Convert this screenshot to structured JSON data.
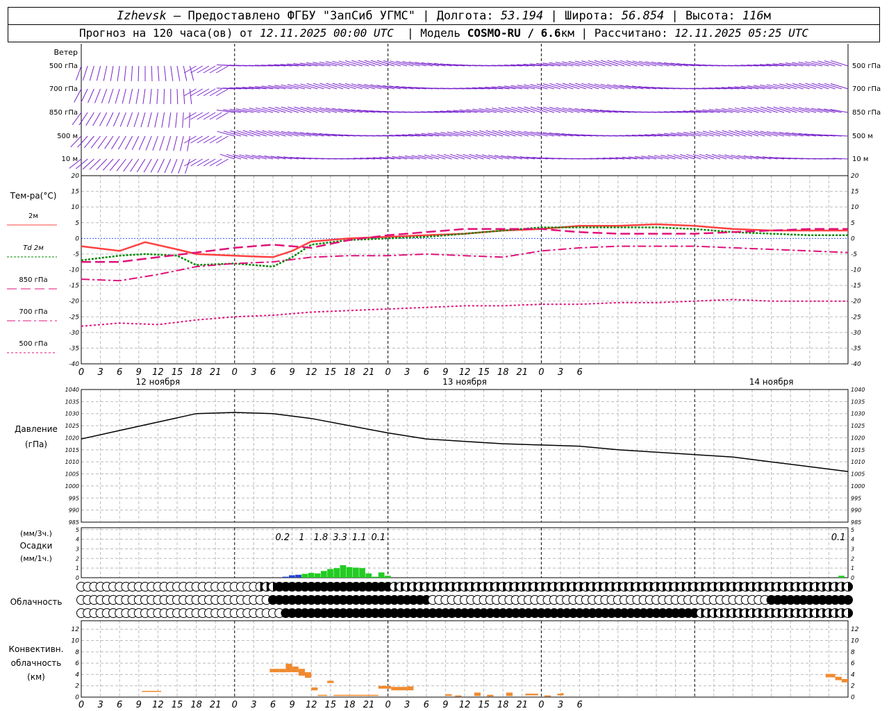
{
  "header": {
    "city": "Izhevsk",
    "provider": "– Предоставлено ФГБУ \"ЗапСиб УГМС\" | Долгота:",
    "lon": "53.194",
    "lat_label": "| Широта:",
    "lat": "56.854",
    "alt_label": "| Высота:",
    "alt": "116",
    "alt_unit": "м",
    "forecast_label": "Прогноз на 120 часа(ов) от",
    "forecast_time": "12.11.2025 00:00 UTC",
    "model_label": "| Модель",
    "model": "COSMO-RU / 6.6",
    "model_unit": "км",
    "calc_label": "| Рассчитано:",
    "calc_time": "12.11.2025 05:25 UTC"
  },
  "time_axis": {
    "hour_labels": [
      "0",
      "3",
      "6",
      "9",
      "12",
      "15",
      "18",
      "21",
      "0",
      "3",
      "6",
      "9",
      "12",
      "15",
      "18",
      "21",
      "0",
      "3",
      "6",
      "9",
      "12",
      "15",
      "18",
      "21",
      "0",
      "3",
      "6"
    ],
    "day_labels": [
      "12 ноября",
      "13 ноября",
      "14 ноября"
    ]
  },
  "wind_panel": {
    "title": "Ветер",
    "levels_left": [
      "500 гПа",
      "700 гПа",
      "850 гПа",
      "500 м",
      "10 м"
    ],
    "levels_right": [
      "500 гПа",
      "700 гПа",
      "850 гПа",
      "500 м",
      "10 м"
    ]
  },
  "temp_panel": {
    "title": "Тем-ра(°C)",
    "legend": [
      {
        "label": "2м",
        "color": "#ff4040",
        "dash": ""
      },
      {
        "label": "Td 2м",
        "color": "#008800",
        "dash": "3,2"
      },
      {
        "label": "850 гПа",
        "color": "#e0107a",
        "dash": "14,6"
      },
      {
        "label": "700 гПа",
        "color": "#e0107a",
        "dash": "12,4,3,4"
      },
      {
        "label": "500 гПа",
        "color": "#e0107a",
        "dash": "3,3"
      }
    ],
    "yticks": [
      "20",
      "15",
      "10",
      "5",
      "0",
      "-5",
      "-10",
      "-15",
      "-20",
      "-25",
      "-30",
      "-35",
      "-40"
    ]
  },
  "pressure_panel": {
    "title": "Давление",
    "unit": "(гПа)",
    "yticks": [
      "1040",
      "1035",
      "1030",
      "1025",
      "1020",
      "1015",
      "1010",
      "1005",
      "1000",
      "995",
      "990",
      "985"
    ]
  },
  "precip_panel": {
    "unit_top": "(мм/3ч.)",
    "title": "Осадки",
    "unit_bottom": "(мм/1ч.)",
    "yticks": [
      "5",
      "4",
      "3",
      "2",
      "1",
      "0"
    ],
    "amounts": [
      "0.2",
      "1",
      "1.8",
      "3.3",
      "1.1",
      "0.1",
      "0.1"
    ]
  },
  "cloud_panel": {
    "title": "Облачность"
  },
  "conv_panel": {
    "title": "Конвективн.",
    "title2": "облачность",
    "unit": "(км)",
    "yticks": [
      "12",
      "10",
      "8",
      "6",
      "4",
      "2",
      "0"
    ]
  },
  "chart_data": [
    {
      "type": "line",
      "title": "Тем-ра(°C)",
      "x_unit": "hours from 12.11.2025 00:00 UTC",
      "ylim": [
        -40,
        20
      ],
      "series": [
        {
          "name": "2м",
          "x": [
            0,
            6,
            10,
            15,
            18,
            24,
            30,
            33,
            36,
            42,
            48,
            54,
            60,
            66,
            72,
            78,
            84,
            90,
            96,
            102,
            108,
            114,
            120
          ],
          "values": [
            -2.5,
            -4.0,
            -1.2,
            -3.5,
            -5.0,
            -5.5,
            -6.0,
            -4.0,
            -1.0,
            0,
            0.5,
            1.0,
            1.5,
            2.5,
            3.0,
            4.0,
            4.0,
            4.5,
            4.0,
            3.0,
            2.5,
            2.5,
            2.5
          ]
        },
        {
          "name": "Td 2м",
          "x": [
            0,
            6,
            10,
            15,
            18,
            24,
            30,
            33,
            36,
            42,
            48,
            54,
            60,
            66,
            72,
            78,
            84,
            90,
            96,
            102,
            108,
            114,
            120
          ],
          "values": [
            -7.0,
            -5.5,
            -5.0,
            -5.5,
            -8.5,
            -8.0,
            -9.0,
            -6.0,
            -2.0,
            -0.5,
            0,
            0.5,
            1.5,
            2.5,
            3.5,
            3.5,
            3.5,
            3.5,
            3.0,
            2.0,
            1.5,
            1.0,
            1.0
          ]
        },
        {
          "name": "850 гПа",
          "x": [
            0,
            6,
            12,
            18,
            24,
            30,
            36,
            42,
            48,
            54,
            60,
            66,
            72,
            78,
            84,
            90,
            96,
            102,
            108,
            114,
            120
          ],
          "values": [
            -7.5,
            -7.5,
            -6.0,
            -4.5,
            -3.0,
            -2.0,
            -3.0,
            -0.5,
            1.0,
            2.0,
            3.0,
            3.0,
            3.0,
            2.0,
            1.5,
            1.5,
            1.5,
            2.0,
            2.5,
            3.0,
            3.0
          ]
        },
        {
          "name": "700 гПа",
          "x": [
            0,
            6,
            12,
            18,
            24,
            30,
            36,
            42,
            48,
            54,
            60,
            66,
            72,
            78,
            84,
            90,
            96,
            102,
            108,
            114,
            120
          ],
          "values": [
            -13.0,
            -13.5,
            -11.5,
            -9.0,
            -8.0,
            -7.5,
            -6.0,
            -5.5,
            -5.5,
            -5.0,
            -5.5,
            -6.0,
            -4.0,
            -3.0,
            -2.5,
            -2.5,
            -2.5,
            -3.0,
            -3.5,
            -4.0,
            -4.5
          ]
        },
        {
          "name": "500 гПа",
          "x": [
            0,
            6,
            12,
            18,
            24,
            30,
            36,
            42,
            48,
            54,
            60,
            66,
            72,
            78,
            84,
            90,
            96,
            102,
            108,
            114,
            120
          ],
          "values": [
            -28.0,
            -27.0,
            -27.5,
            -26.0,
            -25.0,
            -24.5,
            -23.5,
            -23.0,
            -22.5,
            -22.0,
            -21.5,
            -21.5,
            -21.0,
            -21.0,
            -20.5,
            -20.5,
            -20.0,
            -19.5,
            -20.0,
            -20.0,
            -20.0
          ]
        }
      ]
    },
    {
      "type": "line",
      "title": "Давление",
      "x_unit": "hours from 12.11.2025 00:00 UTC",
      "ylim": [
        985,
        1040
      ],
      "series": [
        {
          "name": "",
          "x": [
            0,
            6,
            12,
            18,
            24,
            30,
            36,
            42,
            48,
            54,
            60,
            66,
            72,
            78,
            84,
            90,
            96,
            102,
            108,
            114,
            120
          ],
          "values": [
            1019.5,
            1023,
            1026.5,
            1030,
            1030.5,
            1030,
            1028,
            1025,
            1022,
            1019.5,
            1018.5,
            1017.5,
            1017,
            1016.5,
            1015,
            1014,
            1013,
            1012,
            1010,
            1008,
            1006
          ]
        }
      ]
    },
    {
      "type": "bar",
      "title": "Осадки",
      "x_unit": "hours from 12.11.2025 00:00 UTC",
      "ylim": [
        0,
        5
      ],
      "bars": [
        {
          "x": 32.0,
          "v": 0.1,
          "c": "#2244cc"
        },
        {
          "x": 33.0,
          "v": 0.25,
          "c": "#2244cc"
        },
        {
          "x": 34.0,
          "v": 0.3,
          "c": "#2244cc"
        },
        {
          "x": 35.0,
          "v": 0.4,
          "c": "#22cc22"
        },
        {
          "x": 36.0,
          "v": 0.5,
          "c": "#22cc22"
        },
        {
          "x": 37.0,
          "v": 0.45,
          "c": "#22cc22"
        },
        {
          "x": 38.0,
          "v": 0.7,
          "c": "#22cc22"
        },
        {
          "x": 39.0,
          "v": 0.9,
          "c": "#22cc22"
        },
        {
          "x": 40.0,
          "v": 1.0,
          "c": "#22cc22"
        },
        {
          "x": 41.0,
          "v": 1.3,
          "c": "#22cc22"
        },
        {
          "x": 42.0,
          "v": 1.1,
          "c": "#22cc22"
        },
        {
          "x": 43.0,
          "v": 1.05,
          "c": "#22cc22"
        },
        {
          "x": 44.0,
          "v": 1.0,
          "c": "#22cc22"
        },
        {
          "x": 45.0,
          "v": 0.45,
          "c": "#22cc22"
        },
        {
          "x": 46.0,
          "v": 0.1,
          "c": "#22cc22"
        },
        {
          "x": 47.0,
          "v": 0.55,
          "c": "#22cc22"
        },
        {
          "x": 48.0,
          "v": 0.2,
          "c": "#22cc22"
        },
        {
          "x": 119.0,
          "v": 0.2,
          "c": "#22cc22"
        }
      ],
      "labels": [
        {
          "x": 31.5,
          "text_key": 0
        },
        {
          "x": 34.5,
          "text_key": 1
        },
        {
          "x": 37.5,
          "text_key": 2
        },
        {
          "x": 40.5,
          "text_key": 3
        },
        {
          "x": 43.5,
          "text_key": 4
        },
        {
          "x": 46.5,
          "text_key": 5
        },
        {
          "x": 118.5,
          "text_key": 6
        }
      ]
    },
    {
      "type": "bar",
      "title": "Конвективн. облачность",
      "x_unit": "hours from 12.11.2025 00:00 UTC",
      "ylim": [
        0,
        13
      ],
      "segments": [
        {
          "x0": 9.5,
          "x1": 12.5,
          "base": 1.0,
          "top": 1.1
        },
        {
          "x0": 29.5,
          "x1": 31.0,
          "base": 4.4,
          "top": 5.0
        },
        {
          "x0": 31.0,
          "x1": 32.0,
          "base": 4.4,
          "top": 5.0
        },
        {
          "x0": 32.0,
          "x1": 33.0,
          "base": 4.4,
          "top": 5.9
        },
        {
          "x0": 33.0,
          "x1": 34.0,
          "base": 4.4,
          "top": 5.4
        },
        {
          "x0": 34.0,
          "x1": 35.0,
          "base": 3.8,
          "top": 5.0
        },
        {
          "x0": 35.0,
          "x1": 36.0,
          "base": 3.4,
          "top": 4.4
        },
        {
          "x0": 36.0,
          "x1": 37.0,
          "base": 1.2,
          "top": 1.7
        },
        {
          "x0": 37.0,
          "x1": 38.5,
          "base": 0.2,
          "top": 0.4
        },
        {
          "x0": 38.5,
          "x1": 39.5,
          "base": 2.5,
          "top": 2.9
        },
        {
          "x0": 39.5,
          "x1": 41.0,
          "base": 0.2,
          "top": 0.4
        },
        {
          "x0": 41.0,
          "x1": 46.5,
          "base": 0.2,
          "top": 0.4
        },
        {
          "x0": 46.5,
          "x1": 48.5,
          "base": 1.5,
          "top": 2.0
        },
        {
          "x0": 48.5,
          "x1": 51.0,
          "base": 1.2,
          "top": 1.8
        },
        {
          "x0": 51.0,
          "x1": 52.0,
          "base": 1.2,
          "top": 1.9
        },
        {
          "x0": 57.0,
          "x1": 58.0,
          "base": 0.2,
          "top": 0.5
        },
        {
          "x0": 58.5,
          "x1": 59.5,
          "base": 0.1,
          "top": 0.3
        },
        {
          "x0": 61.5,
          "x1": 62.5,
          "base": 0.2,
          "top": 0.8
        },
        {
          "x0": 63.5,
          "x1": 64.5,
          "base": 0.1,
          "top": 0.4
        },
        {
          "x0": 66.5,
          "x1": 67.5,
          "base": 0.2,
          "top": 0.8
        },
        {
          "x0": 69.5,
          "x1": 71.5,
          "base": 0.3,
          "top": 0.6
        },
        {
          "x0": 72.5,
          "x1": 73.5,
          "base": 0.1,
          "top": 0.3
        },
        {
          "x0": 74.5,
          "x1": 75.0,
          "base": 0.3,
          "top": 0.6
        },
        {
          "x0": 75.0,
          "x1": 75.5,
          "base": 0.3,
          "top": 0.7
        },
        {
          "x0": 116.5,
          "x1": 118.0,
          "base": 3.5,
          "top": 4.1
        },
        {
          "x0": 118.0,
          "x1": 119.0,
          "base": 3.0,
          "top": 3.6
        },
        {
          "x0": 119.0,
          "x1": 120.0,
          "base": 2.6,
          "top": 3.2
        }
      ]
    }
  ]
}
